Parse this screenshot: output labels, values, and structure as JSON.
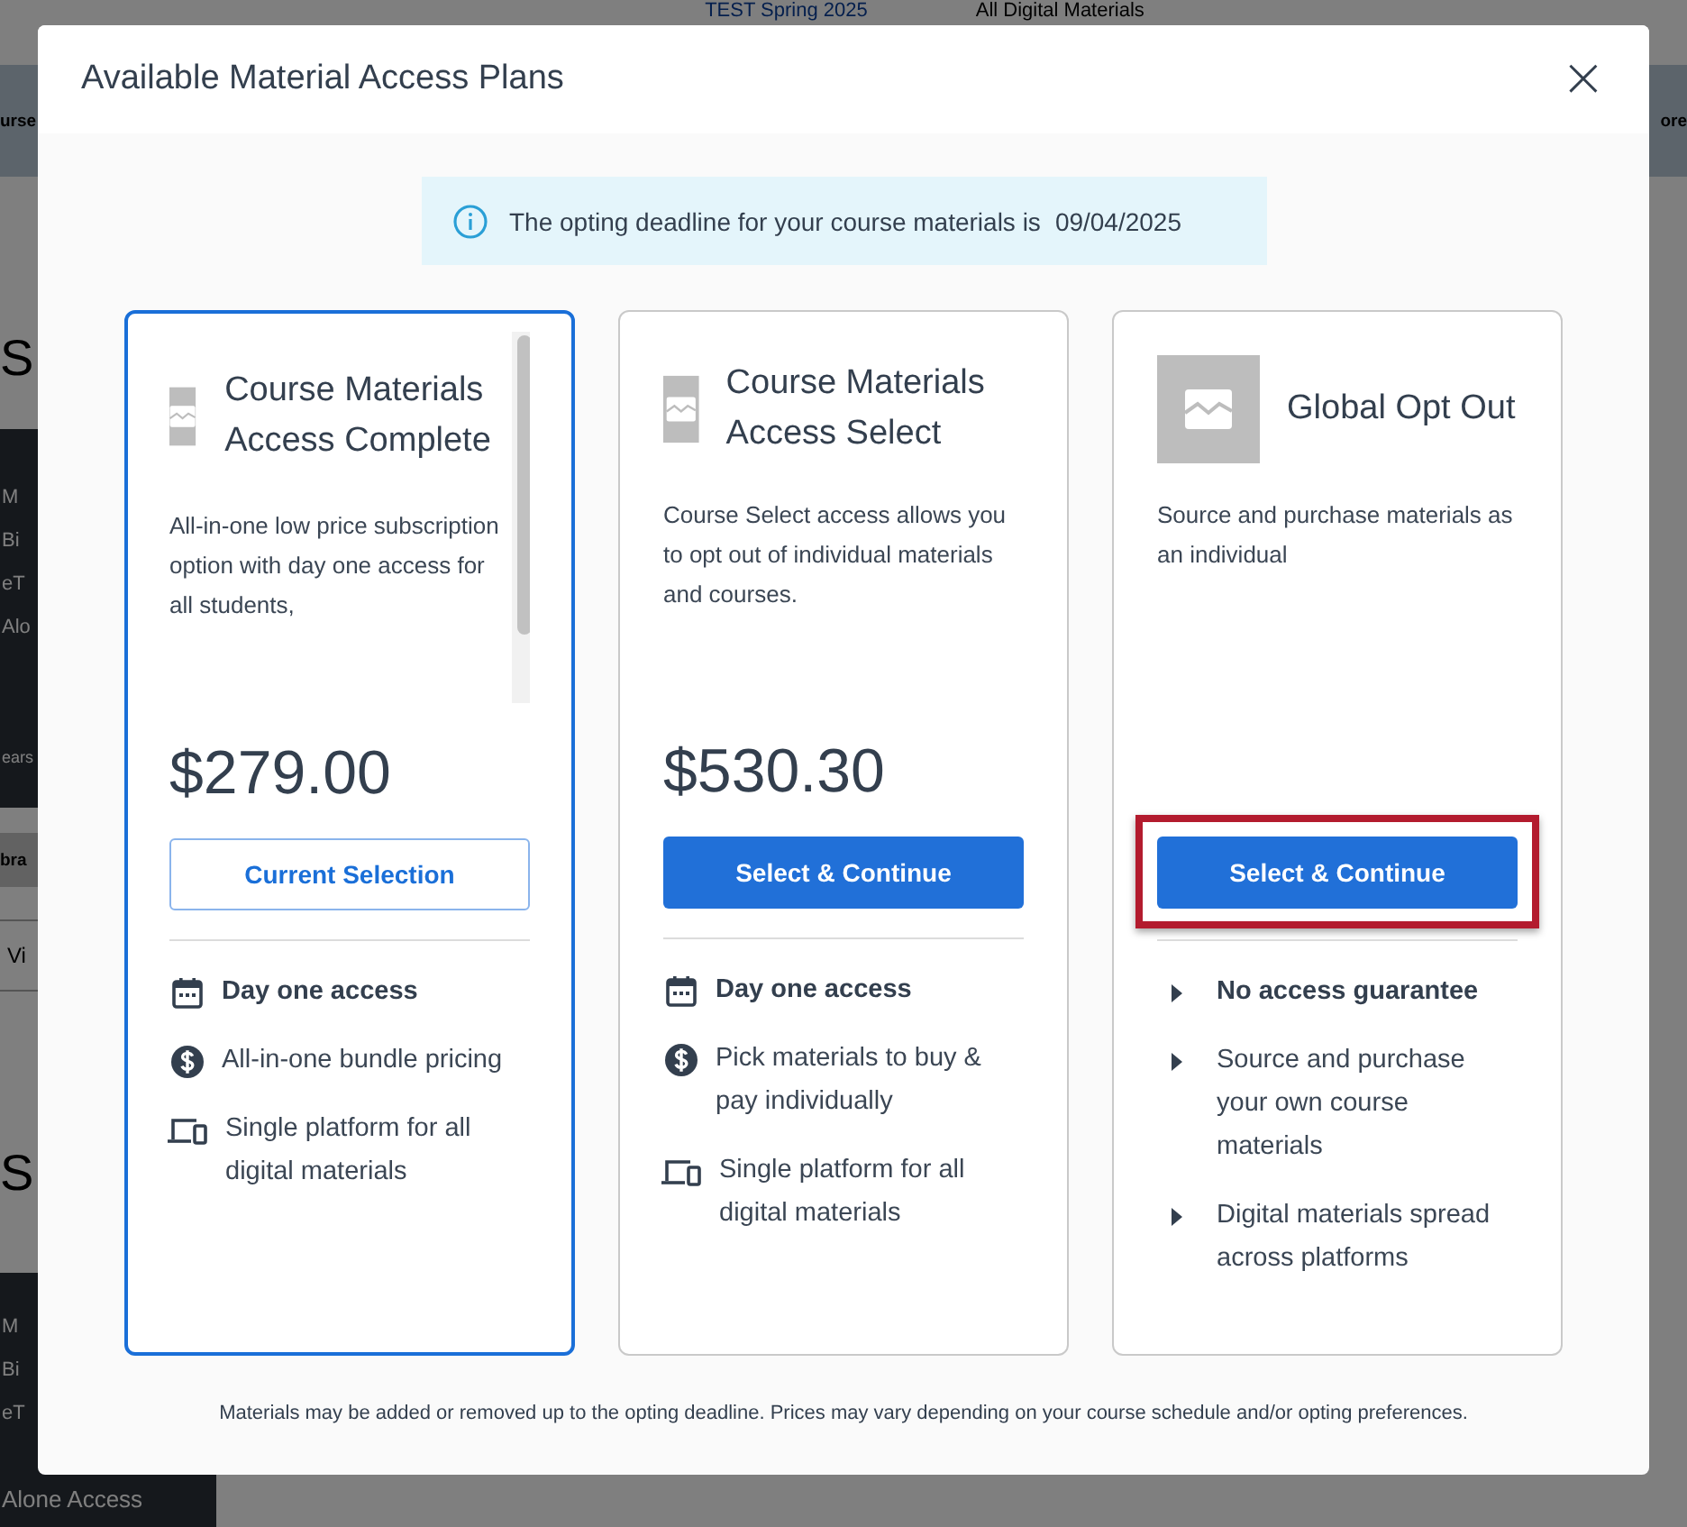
{
  "background": {
    "top_links": [
      {
        "label": "TEST Spring 2025",
        "selected": true
      },
      {
        "label": "All Digital Materials",
        "selected": false
      }
    ],
    "left_fragments": [
      {
        "kind": "bar",
        "text": "urse"
      },
      {
        "kind": "heading",
        "text": "S"
      },
      {
        "kind": "panel",
        "lines": [
          "M",
          "Bi",
          "eT",
          "Alo"
        ],
        "note": "ears"
      },
      {
        "kind": "tab",
        "text": "bra"
      },
      {
        "kind": "row",
        "text": "Vi"
      },
      {
        "kind": "heading",
        "text": "S"
      },
      {
        "kind": "panel",
        "lines": [
          "M",
          "Bi",
          "eT"
        ],
        "note": "Alone Access"
      }
    ],
    "right_fragment": "ore"
  },
  "dialog": {
    "title": "Available Material Access Plans",
    "close": "×",
    "notice": {
      "text": "The opting deadline for your course materials is",
      "date": "09/04/2025"
    },
    "plans": [
      {
        "title": "Course Materials Access Complete",
        "description": "All-in-one low price subscription option with day one access for all students,",
        "scrollable": true,
        "price": "$279.00",
        "selected": true,
        "highlighted": false,
        "button": "Current Selection",
        "features": [
          {
            "kind": "calendar",
            "text": "Day one access",
            "emphasis": true
          },
          {
            "kind": "dollar",
            "text": "All-in-one bundle pricing",
            "emphasis": false
          },
          {
            "kind": "devices",
            "text": "Single platform for all digital materials",
            "emphasis": false
          }
        ]
      },
      {
        "title": "Course Materials Access Select",
        "description": "Course Select access allows you to opt out of individual materials and courses.",
        "scrollable": false,
        "price": "$530.30",
        "selected": false,
        "highlighted": false,
        "button": "Select & Continue",
        "features": [
          {
            "kind": "calendar",
            "text": "Day one access",
            "emphasis": true
          },
          {
            "kind": "dollar",
            "text": "Pick materials to buy & pay individually",
            "emphasis": false
          },
          {
            "kind": "devices",
            "text": "Single platform for all digital materials",
            "emphasis": false
          }
        ]
      },
      {
        "title": "Global Opt Out",
        "description": "Source and purchase materials as an individual",
        "scrollable": false,
        "selected": false,
        "highlighted": true,
        "button": "Select & Continue",
        "features": [
          {
            "kind": "bullet",
            "text": "No access guarantee",
            "emphasis": true
          },
          {
            "kind": "bullet",
            "text": "Source and purchase your own course materials",
            "emphasis": false
          },
          {
            "kind": "bullet",
            "text": "Digital materials spread across platforms",
            "emphasis": false
          }
        ]
      }
    ],
    "footnote": "Materials may be added or removed up to the opting deadline. Prices may vary depending on your course schedule and/or opting preferences."
  }
}
